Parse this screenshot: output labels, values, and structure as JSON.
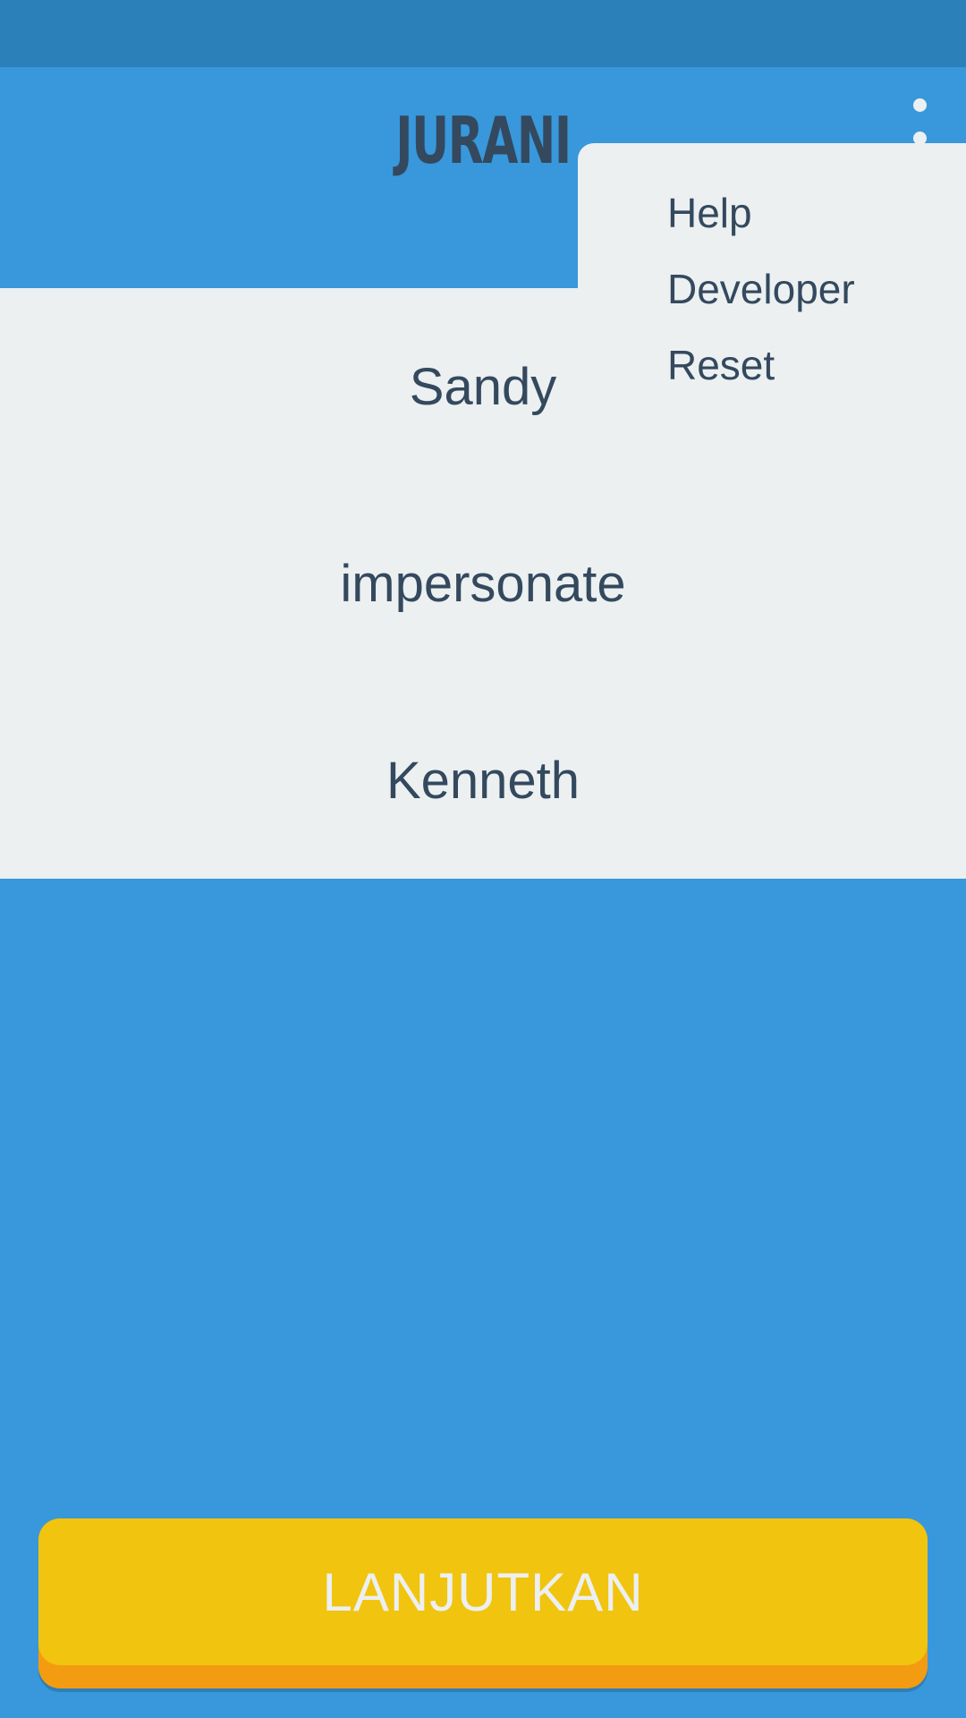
{
  "app": {
    "title": "JURANI"
  },
  "words": [
    "Sandy",
    "impersonate",
    "Kenneth"
  ],
  "menu": {
    "items": [
      "Help",
      "Developer",
      "Reset"
    ]
  },
  "continue_button": {
    "label": "LANJUTKAN"
  },
  "colors": {
    "status_bar": "#2b80ba",
    "primary": "#3898db",
    "panel": "#ecf0f1",
    "text": "#34495e",
    "button": "#f1c40f",
    "button_shadow": "#f39c12"
  },
  "icons": {
    "overflow": "more-vert-icon"
  }
}
